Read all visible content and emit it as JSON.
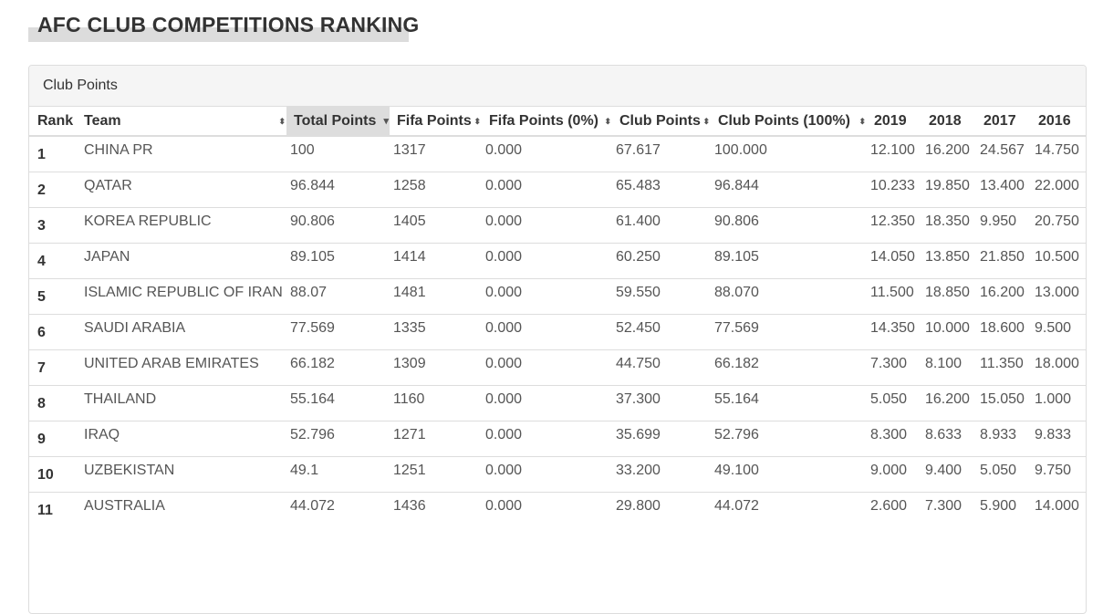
{
  "page_title": "AFC CLUB COMPETITIONS RANKING",
  "panel_title": "Club Points",
  "columns": [
    "Rank",
    "Team",
    "Total Points",
    "Fifa Points",
    "Fifa Points (0%)",
    "Club Points",
    "Club Points (100%)",
    "2019",
    "2018",
    "2017",
    "2016"
  ],
  "sorted_column": "Total Points",
  "rows": [
    [
      "1",
      "CHINA PR",
      "100",
      "1317",
      "0.000",
      "67.617",
      "100.000",
      "12.100",
      "16.200",
      "24.567",
      "14.750"
    ],
    [
      "2",
      "QATAR",
      "96.844",
      "1258",
      "0.000",
      "65.483",
      "96.844",
      "10.233",
      "19.850",
      "13.400",
      "22.000"
    ],
    [
      "3",
      "KOREA REPUBLIC",
      "90.806",
      "1405",
      "0.000",
      "61.400",
      "90.806",
      "12.350",
      "18.350",
      "9.950",
      "20.750"
    ],
    [
      "4",
      "JAPAN",
      "89.105",
      "1414",
      "0.000",
      "60.250",
      "89.105",
      "14.050",
      "13.850",
      "21.850",
      "10.500"
    ],
    [
      "5",
      "ISLAMIC REPUBLIC OF IRAN",
      "88.07",
      "1481",
      "0.000",
      "59.550",
      "88.070",
      "11.500",
      "18.850",
      "16.200",
      "13.000"
    ],
    [
      "6",
      "SAUDI ARABIA",
      "77.569",
      "1335",
      "0.000",
      "52.450",
      "77.569",
      "14.350",
      "10.000",
      "18.600",
      "9.500"
    ],
    [
      "7",
      "UNITED ARAB EMIRATES",
      "66.182",
      "1309",
      "0.000",
      "44.750",
      "66.182",
      "7.300",
      "8.100",
      "11.350",
      "18.000"
    ],
    [
      "8",
      "THAILAND",
      "55.164",
      "1160",
      "0.000",
      "37.300",
      "55.164",
      "5.050",
      "16.200",
      "15.050",
      "1.000"
    ],
    [
      "9",
      "IRAQ",
      "52.796",
      "1271",
      "0.000",
      "35.699",
      "52.796",
      "8.300",
      "8.633",
      "8.933",
      "9.833"
    ],
    [
      "10",
      "UZBEKISTAN",
      "49.1",
      "1251",
      "0.000",
      "33.200",
      "49.100",
      "9.000",
      "9.400",
      "5.050",
      "9.750"
    ],
    [
      "11",
      "AUSTRALIA",
      "44.072",
      "1436",
      "0.000",
      "29.800",
      "44.072",
      "2.600",
      "7.300",
      "5.900",
      "14.000"
    ]
  ]
}
